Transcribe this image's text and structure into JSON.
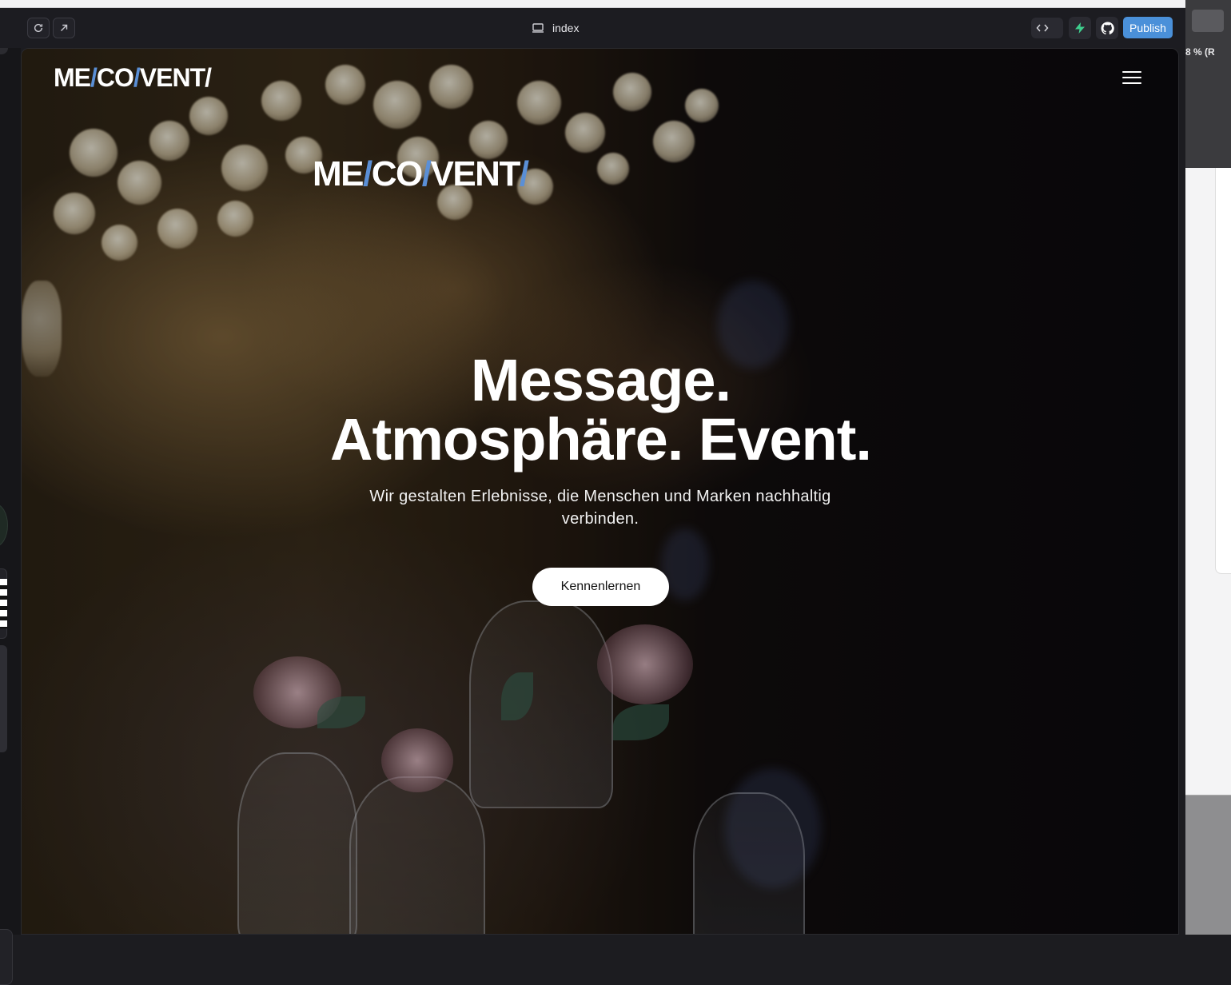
{
  "toolbar": {
    "tab_title": "index",
    "publish_label": "Publish"
  },
  "right_panel": {
    "zoom_text": "8 % (R"
  },
  "site": {
    "nav_logo": {
      "part1": "ME",
      "slash1": "/",
      "part2": "CO",
      "slash2": "/",
      "part3": "VENT",
      "slash3": "/"
    },
    "hero_logo": {
      "part1": "ME",
      "slash1": "/",
      "part2": "CO",
      "slash2": "/",
      "part3": "VENT",
      "slash3": "/"
    },
    "headline_line1": "Message.",
    "headline_line2": "Atmosphäre. Event.",
    "subline": "Wir gestalten Erlebnisse, die Menschen und Marken nachhaltig verbinden.",
    "cta_label": "Kennenlernen"
  },
  "colors": {
    "publish_bg": "#4a90d9",
    "logo_accent": "#5a8fd6",
    "cta_bg": "#ffffff"
  }
}
